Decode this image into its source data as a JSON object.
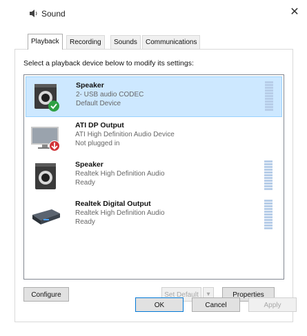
{
  "window": {
    "title": "Sound",
    "close_glyph": "✕"
  },
  "tabs": [
    {
      "label": "Playback"
    },
    {
      "label": "Recording"
    },
    {
      "label": "Sounds"
    },
    {
      "label": "Communications"
    }
  ],
  "instruction": "Select a playback device below to modify its settings:",
  "devices": [
    {
      "name": "Speaker",
      "line1": "2- USB audio CODEC",
      "line2": "Default Device",
      "icon": "speaker-icon",
      "status": "default-check",
      "selected": true
    },
    {
      "name": "ATI DP Output",
      "line1": "ATI High Definition Audio Device",
      "line2": "Not plugged in",
      "icon": "monitor-icon",
      "status": "unplugged-arrow",
      "selected": false
    },
    {
      "name": "Speaker",
      "line1": "Realtek High Definition Audio",
      "line2": "Ready",
      "icon": "speaker-icon",
      "status": "none",
      "selected": false
    },
    {
      "name": "Realtek Digital Output",
      "line1": "Realtek High Definition Audio",
      "line2": "Ready",
      "icon": "digital-output-icon",
      "status": "none",
      "selected": false
    }
  ],
  "buttons": {
    "configure": "Configure",
    "set_default": "Set Default",
    "properties": "Properties",
    "ok": "OK",
    "cancel": "Cancel",
    "apply": "Apply"
  },
  "colors": {
    "selection": "#cde8ff",
    "default_check": "#2ea043",
    "unplugged": "#d13438"
  }
}
